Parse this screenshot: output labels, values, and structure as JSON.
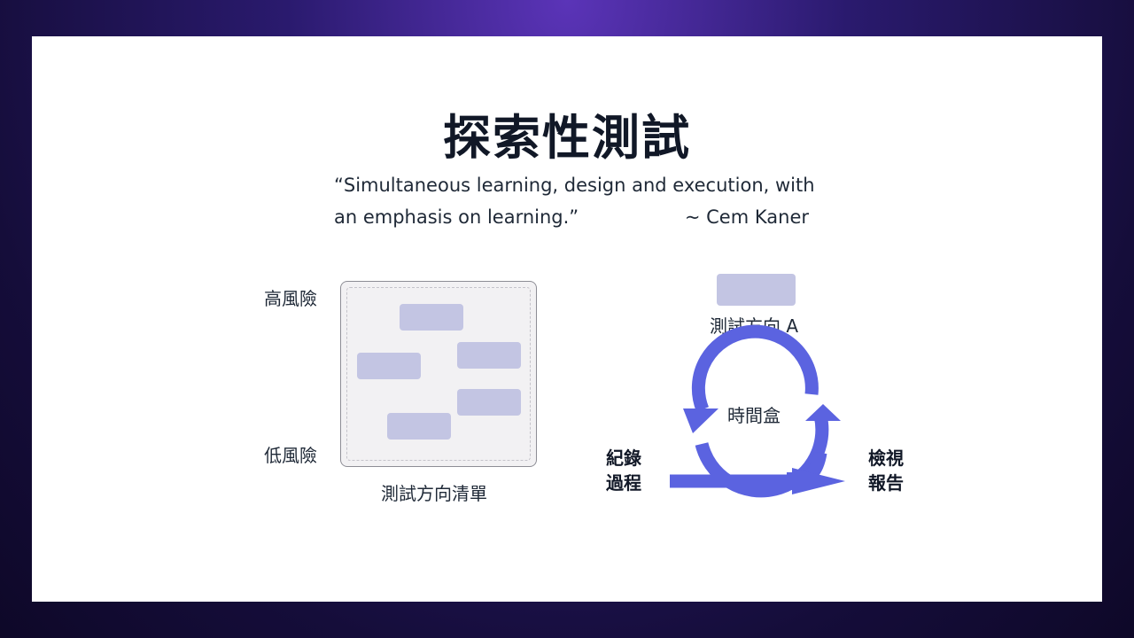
{
  "slide": {
    "title": "探索性測試",
    "quote": {
      "line1": "“Simultaneous learning, design and execution, with",
      "line2": "an emphasis on learning.”",
      "author": "~ Cem Kaner"
    }
  },
  "diagram": {
    "risk_high_label": "高風險",
    "risk_low_label": "低風險",
    "list_caption": "測試方向清單",
    "direction_a_label": "測試方向 A",
    "timebox_label": "時間盒",
    "record_label_line1": "紀錄",
    "record_label_line2": "過程",
    "report_label_line1": "檢視",
    "report_label_line2": "報告",
    "colors": {
      "accent": "#5b63e0",
      "chip": "#c3c5e3",
      "box_border": "#8d8d95",
      "box_fill": "#f2f1f3"
    }
  }
}
